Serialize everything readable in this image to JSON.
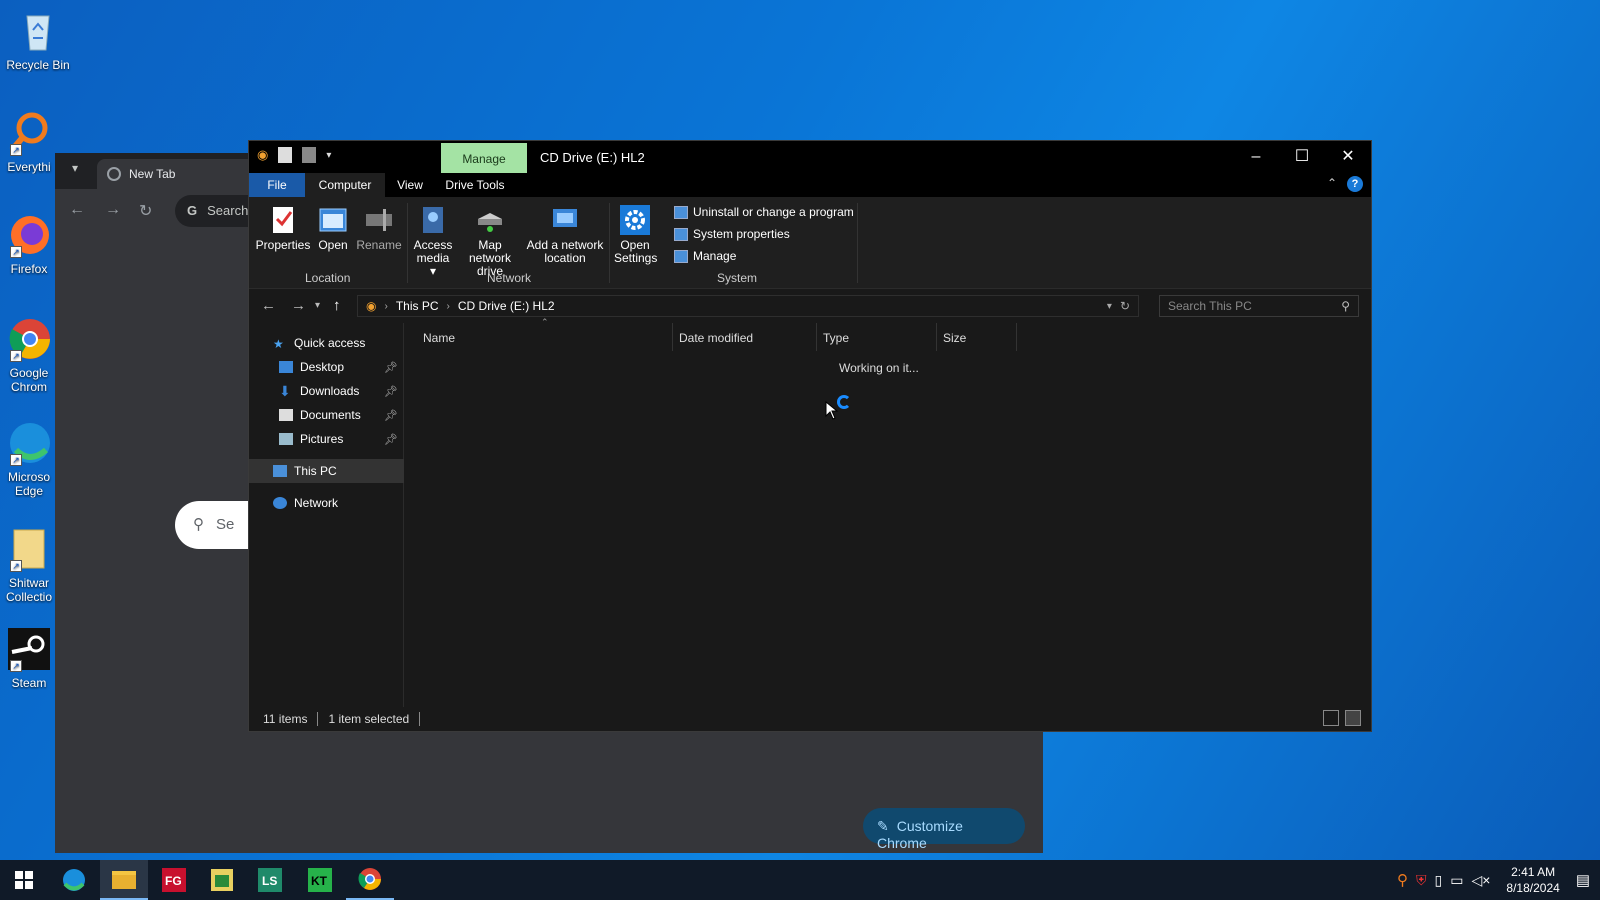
{
  "desktop": {
    "icons": [
      {
        "label": "Recycle Bin"
      },
      {
        "label": "Everythi"
      },
      {
        "label": "Firefox"
      },
      {
        "label": "Google Chrom"
      },
      {
        "label": "Microso Edge"
      },
      {
        "label": "Shitwar Collectio"
      },
      {
        "label": "Steam"
      }
    ]
  },
  "chrome": {
    "tab_title": "New Tab",
    "omnibox_text": "Search",
    "search_placeholder": "Se",
    "customize_label": "Customize Chrome"
  },
  "explorer": {
    "title": "CD Drive (E:) HL2",
    "context_tab": "Manage",
    "tabs": [
      "File",
      "Computer",
      "View",
      "Drive Tools"
    ],
    "ribbon": {
      "location": {
        "label": "Location",
        "buttons": [
          "Properties",
          "Open",
          "Rename"
        ]
      },
      "network": {
        "label": "Network",
        "buttons": [
          "Access media",
          "Map network drive",
          "Add a network location"
        ]
      },
      "system": {
        "label": "System",
        "open_settings": "Open Settings",
        "items": [
          "Uninstall or change a program",
          "System properties",
          "Manage"
        ]
      }
    },
    "address": {
      "crumbs": [
        "This PC",
        "CD Drive (E:) HL2"
      ]
    },
    "search_placeholder": "Search This PC",
    "nav": {
      "quick_access": "Quick access",
      "pinned": [
        "Desktop",
        "Downloads",
        "Documents",
        "Pictures"
      ],
      "this_pc": "This PC",
      "network": "Network"
    },
    "columns": [
      "Name",
      "Date modified",
      "Type",
      "Size"
    ],
    "loading_text": "Working on it...",
    "status": {
      "items": "11 items",
      "selected": "1 item selected"
    }
  },
  "taskbar": {
    "time": "2:41 AM",
    "date": "8/18/2024"
  }
}
